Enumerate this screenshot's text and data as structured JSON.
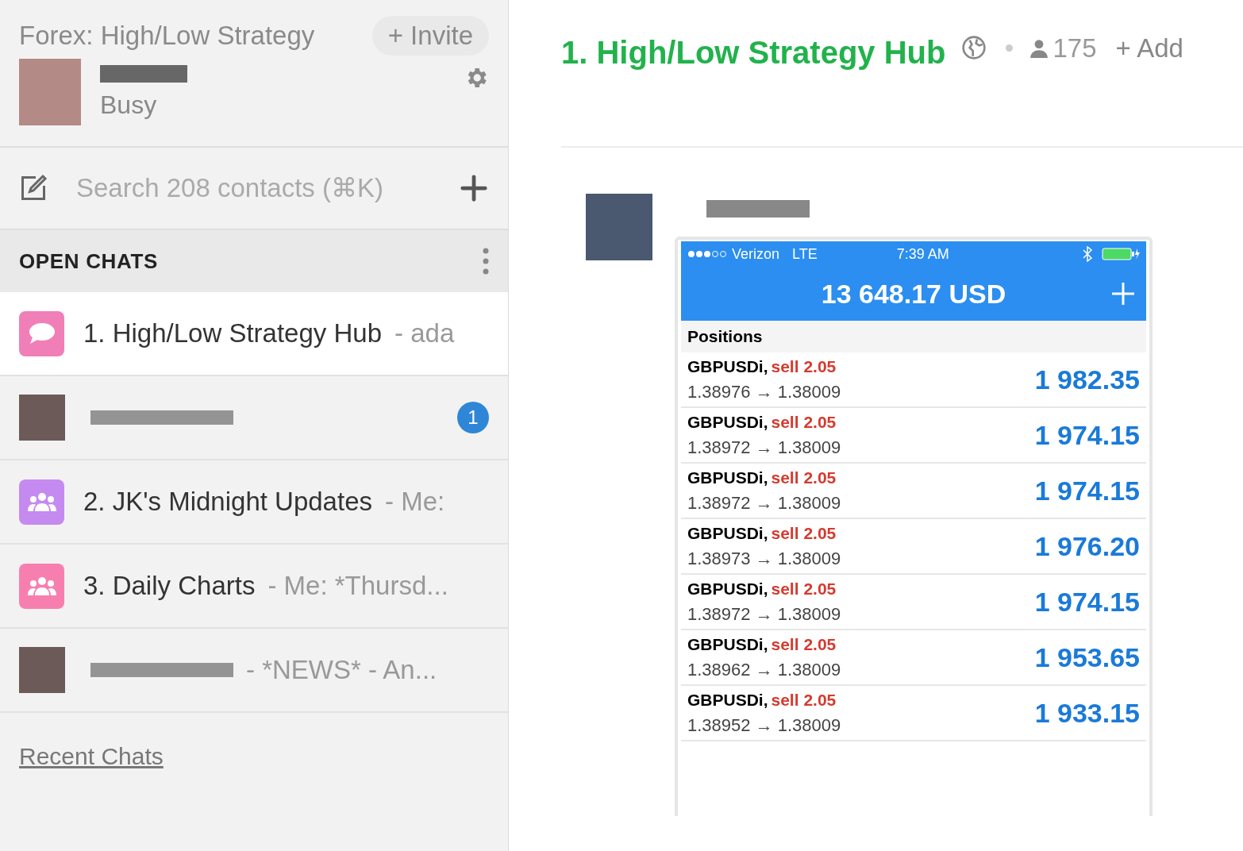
{
  "sidebar": {
    "team_name": "Forex: High/Low Strategy",
    "invite_button": "+ Invite",
    "user": {
      "status": "Busy"
    },
    "search": {
      "placeholder": "Search 208 contacts (⌘K)"
    },
    "section_title": "OPEN CHATS",
    "chats": [
      {
        "kind": "group",
        "color": "#f07fb8",
        "title": "1. High/Low Strategy Hub",
        "preview": "- ada",
        "selected": true
      },
      {
        "kind": "person",
        "unread": "1",
        "selected": false
      },
      {
        "kind": "group",
        "color": "#c58af0",
        "title": "2. JK's Midnight Updates",
        "preview": "- Me:",
        "selected": false
      },
      {
        "kind": "group",
        "color": "#f77fb0",
        "title": "3. Daily Charts",
        "preview": "- Me: *Thursd...",
        "selected": false
      },
      {
        "kind": "person",
        "preview": "- *NEWS* - An...",
        "selected": false
      }
    ],
    "recent_link": "Recent Chats"
  },
  "chat": {
    "title": "1. High/Low Strategy Hub",
    "member_count": "175",
    "add_button": "+ Add",
    "screenshot": {
      "carrier": "Verizon",
      "network": "LTE",
      "time": "7:39 AM",
      "balance": "13 648.17 USD",
      "section": "Positions",
      "positions": [
        {
          "symbol": "GBPUSDi,",
          "side": "sell 2.05",
          "prices": "1.38976 → 1.38009",
          "profit": "1 982.35"
        },
        {
          "symbol": "GBPUSDi,",
          "side": "sell 2.05",
          "prices": "1.38972 → 1.38009",
          "profit": "1 974.15"
        },
        {
          "symbol": "GBPUSDi,",
          "side": "sell 2.05",
          "prices": "1.38972 → 1.38009",
          "profit": "1 974.15"
        },
        {
          "symbol": "GBPUSDi,",
          "side": "sell 2.05",
          "prices": "1.38973 → 1.38009",
          "profit": "1 976.20"
        },
        {
          "symbol": "GBPUSDi,",
          "side": "sell 2.05",
          "prices": "1.38972 → 1.38009",
          "profit": "1 974.15"
        },
        {
          "symbol": "GBPUSDi,",
          "side": "sell 2.05",
          "prices": "1.38962 → 1.38009",
          "profit": "1 953.65"
        },
        {
          "symbol": "GBPUSDi,",
          "side": "sell 2.05",
          "prices": "1.38952 → 1.38009",
          "profit": "1 933.15"
        }
      ]
    }
  }
}
